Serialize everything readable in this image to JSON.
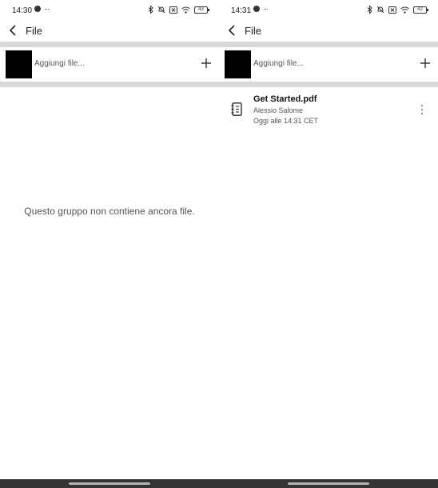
{
  "left_screen": {
    "status": {
      "time": "14:30",
      "battery": "43"
    },
    "app_bar": {
      "title": "File"
    },
    "add_file": {
      "label": "Aggiungi file..."
    },
    "empty_message": "Questo gruppo non contiene ancora file."
  },
  "right_screen": {
    "status": {
      "time": "14:31",
      "battery": "42"
    },
    "app_bar": {
      "title": "File"
    },
    "add_file": {
      "label": "Aggiungi file..."
    },
    "files": [
      {
        "name": "Get Started.pdf",
        "author": "Alessio Salome",
        "date": "Oggi alle 14:31 CET",
        "icon": "pdf-document-icon"
      }
    ]
  },
  "icons": {
    "back": "back-arrow-icon",
    "add": "plus-icon",
    "menu": "more-vert-icon",
    "bluetooth": "bluetooth-icon",
    "dnd": "do-not-disturb-icon",
    "sim": "no-sim-icon",
    "wifi": "wifi-icon",
    "battery": "battery-icon"
  },
  "colors": {
    "divider": "#d9d9d9",
    "nav_bar": "#333333",
    "thumb": "#000000"
  }
}
